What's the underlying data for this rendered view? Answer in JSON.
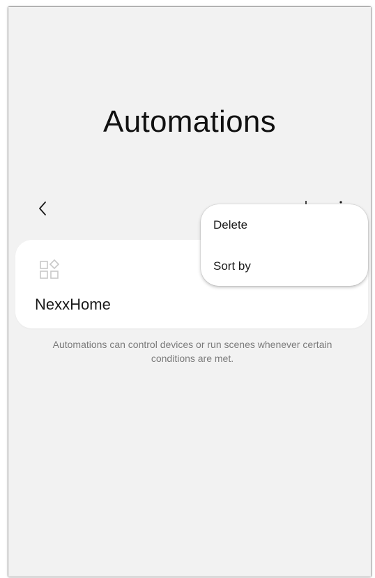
{
  "header": {
    "title": "Automations"
  },
  "toolbar": {
    "back_icon": "chevron-left-icon"
  },
  "automation_card": {
    "label": "NexxHome",
    "icon": "device-grid-icon"
  },
  "helper": {
    "text": "Automations can control devices or run scenes whenever certain conditions are met."
  },
  "menu": {
    "items": [
      {
        "label": "Delete"
      },
      {
        "label": "Sort by"
      }
    ]
  },
  "colors": {
    "background": "#f2f2f2",
    "card": "#ffffff",
    "helper_text": "#7b7b7b"
  }
}
